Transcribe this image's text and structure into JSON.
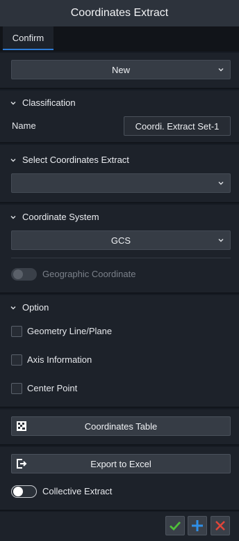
{
  "window": {
    "title": "Coordinates Extract"
  },
  "tabs": [
    {
      "label": "Confirm",
      "active": true
    }
  ],
  "top": {
    "mode_select": "New"
  },
  "classification": {
    "header": "Classification",
    "name_label": "Name",
    "name_value": "Coordi. Extract Set-1"
  },
  "select_coords": {
    "header": "Select Coordinates Extract",
    "selected": ""
  },
  "coord_system": {
    "header": "Coordinate System",
    "selected": "GCS",
    "toggle_label": "Geographic Coordinate",
    "toggle_enabled": false
  },
  "option": {
    "header": "Option",
    "items": [
      {
        "label": "Geometry Line/Plane",
        "checked": false
      },
      {
        "label": "Axis Information",
        "checked": false
      },
      {
        "label": "Center Point",
        "checked": false
      }
    ]
  },
  "table": {
    "button_label": "Coordinates Table",
    "icon": "table-grid-icon"
  },
  "export": {
    "button_label": "Export to Excel",
    "icon": "export-icon",
    "toggle_label": "Collective Extract",
    "toggle_on": false
  },
  "footer": {
    "icons": [
      "confirm-check-icon",
      "add-plus-icon",
      "close-x-icon"
    ],
    "colors": {
      "check": "#4fbf3a",
      "plus": "#2f8fe8",
      "close": "#e0453a"
    }
  },
  "theme": {
    "accent": "#2e7cd6",
    "panel": "#1d222a",
    "background": "#161b23"
  }
}
